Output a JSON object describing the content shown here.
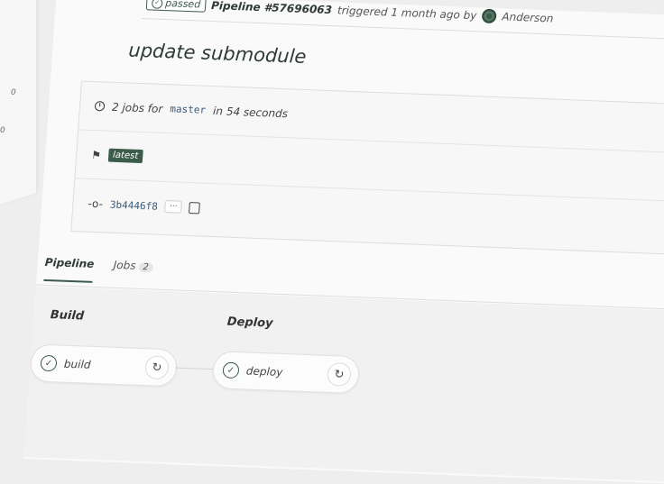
{
  "sidebar": {
    "counts": [
      "0",
      "0"
    ]
  },
  "header": {
    "status": "passed",
    "pipeline_link": "Pipeline #57696063",
    "trigger_text": "triggered 1 month ago by",
    "user": "Anderson"
  },
  "commit_title": "update submodule",
  "info": {
    "jobs_prefix": "2 jobs for",
    "branch": "master",
    "duration": "in 54 seconds",
    "tag": "latest",
    "commit_sha": "3b4446f8",
    "ellipsis": "···"
  },
  "tabs": {
    "pipeline": "Pipeline",
    "jobs": "Jobs",
    "jobs_count": "2"
  },
  "stages": [
    {
      "title": "Build",
      "job": "build"
    },
    {
      "title": "Deploy",
      "job": "deploy"
    }
  ]
}
